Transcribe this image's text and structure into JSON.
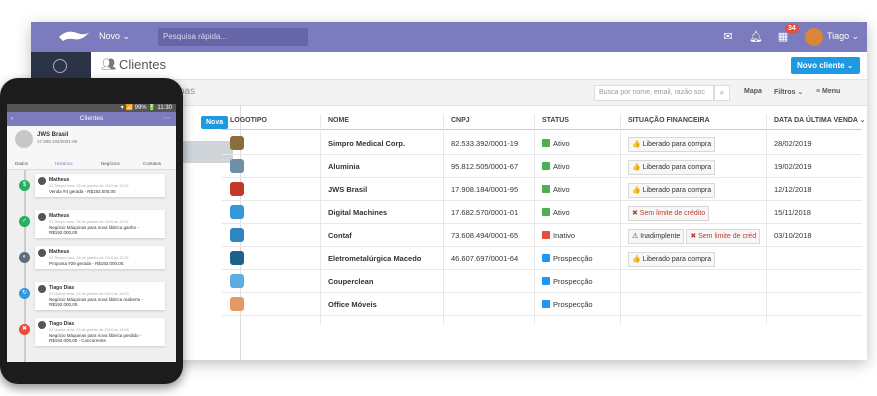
{
  "topbar": {
    "new_label": "Novo ⌄",
    "quick_search_placeholder": "Pesquisa rápida...",
    "notifications_badge": "34",
    "user_name": "Tiago ⌄"
  },
  "page": {
    "title": "Clientes",
    "new_client_button": "Novo cliente ⌄",
    "filter_ghost": "oas"
  },
  "toolbar": {
    "search_placeholder": "Busca por nome, email, razão soc",
    "map_label": "Mapa",
    "filters_label": "Filtros ⌄",
    "menu_label": "≡ Menu"
  },
  "left_panel": {
    "new_button": "Nova"
  },
  "table": {
    "headers": [
      "LOGOTIPO",
      "NOME",
      "CNPJ",
      "STATUS",
      "SITUAÇÃO FINANCEIRA",
      "DATA DA ÚLTIMA VENDA ⌄"
    ],
    "rows": [
      {
        "logo": "#8a6d3b",
        "name": "Simpro Medical Corp.",
        "cnpj": "82.533.392/0001-19",
        "status": "Ativo",
        "status_color": "#4caf50",
        "fin": [
          "👍 Liberado para compra"
        ],
        "fin_colors": [
          "#333"
        ],
        "date": "28/02/2019"
      },
      {
        "logo": "#6d8fa8",
        "name": "Aluminia",
        "cnpj": "95.812.505/0001-67",
        "status": "Ativo",
        "status_color": "#4caf50",
        "fin": [
          "👍 Liberado para compra"
        ],
        "fin_colors": [
          "#333"
        ],
        "date": "19/02/2019"
      },
      {
        "logo": "#c0392b",
        "name": "JWS Brasil",
        "cnpj": "17.908.184/0001-95",
        "status": "Ativo",
        "status_color": "#4caf50",
        "fin": [
          "👍 Liberado para compra"
        ],
        "fin_colors": [
          "#333"
        ],
        "date": "12/12/2018"
      },
      {
        "logo": "#3498db",
        "name": "Digital Machines",
        "cnpj": "17.682.570/0001-01",
        "status": "Ativo",
        "status_color": "#4caf50",
        "fin": [
          "✖ Sem limite de crédito"
        ],
        "fin_colors": [
          "#c0392b"
        ],
        "date": "15/11/2018"
      },
      {
        "logo": "#2e86c1",
        "name": "Contaf",
        "cnpj": "73.608.494/0001-65",
        "status": "Inativo",
        "status_color": "#e74c3c",
        "fin": [
          "⚠ Inadimplente",
          "✖ Sem limite de créd"
        ],
        "fin_colors": [
          "#333",
          "#c0392b"
        ],
        "date": "03/10/2018"
      },
      {
        "logo": "#1f618d",
        "name": "Eletrometalúrgica Macedo",
        "cnpj": "46.607.697/0001-64",
        "status": "Prospecção",
        "status_color": "#2196f3",
        "fin": [
          "👍 Liberado para compra"
        ],
        "fin_colors": [
          "#333"
        ],
        "date": ""
      },
      {
        "logo": "#5dade2",
        "name": "Couperclean",
        "cnpj": "",
        "status": "Prospecção",
        "status_color": "#2196f3",
        "fin": [],
        "fin_colors": [],
        "date": ""
      },
      {
        "logo": "#e59866",
        "name": "Office Móveis",
        "cnpj": "",
        "status": "Prospecção",
        "status_color": "#2196f3",
        "fin": [],
        "fin_colors": [],
        "date": ""
      }
    ]
  },
  "phone": {
    "status_bar": "▾ 📶 99% 🔋 11:30",
    "header_title": "Clientes",
    "client_name": "JWS Brasil",
    "client_cnpj": "17.908.184/0001-95",
    "tabs": [
      "Dados",
      "Histórico",
      "Negócios",
      "Contatos"
    ],
    "timeline_label": "histórico",
    "entries": [
      {
        "who": "Matheus",
        "date": "01 Tempo hora, 28 de janeiro de 2019 às 10:37",
        "text": "Venda #4 gerada - R$192.000,00",
        "dot": "#27ae60",
        "icon": "$"
      },
      {
        "who": "Matheus",
        "date": "01 Tempo hora, 28 de janeiro de 2019 às 10:37",
        "text": "Negócio Máquinas para nova fábrica ganho - R$192.000,00",
        "dot": "#27ae60",
        "icon": "✓"
      },
      {
        "who": "Matheus",
        "date": "01 Tempo hora, 28 de janeiro de 2019 às 10:37",
        "text": "Proposta #29 gerada - R$192.000,00.",
        "dot": "#5d6d7e",
        "icon": "◐"
      },
      {
        "who": "Tiago Dias",
        "date": "01 Quinta-feira, 23 de janeiro de 2019 às 14:20",
        "text": "Negócio Máquinas para nova fábrica reaberto - R$192.000,00.",
        "dot": "#3498db",
        "icon": "↻"
      },
      {
        "who": "Tiago Dias",
        "date": "01 Quinta-feira, 23 de janeiro de 2019 às 14:08",
        "text": "Negócio Máquinas para nova fábrica perdido - R$192.000,00 - Concorrente",
        "dot": "#e74c3c",
        "icon": "✖"
      }
    ]
  }
}
